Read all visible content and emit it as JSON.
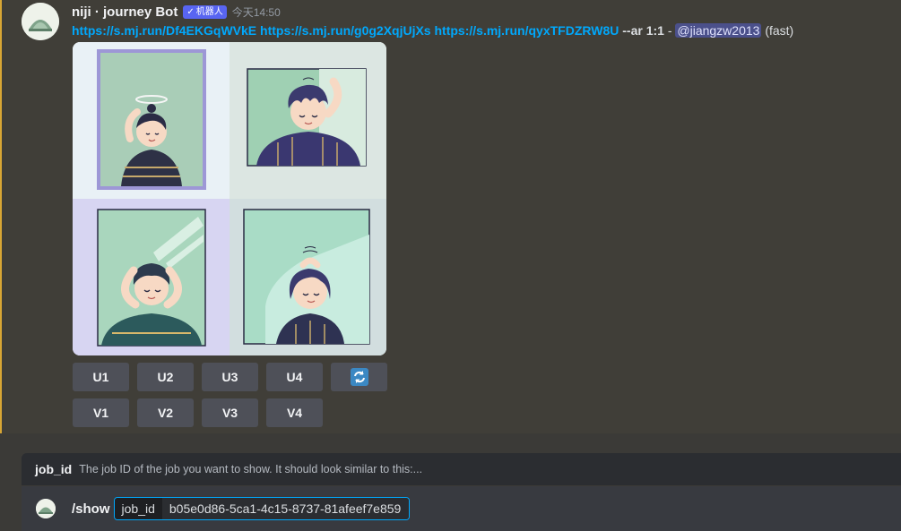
{
  "message": {
    "author": "niji · journey Bot",
    "bot_tag": "机器人",
    "timestamp": "今天14:50",
    "links": [
      "https://s.mj.run/Df4EKGqWVkE",
      "https://s.mj.run/g0g2XqjUjXs",
      "https://s.mj.run/qyxTFDZRW8U"
    ],
    "params": "--ar 1:1",
    "dash": "-",
    "mention": "@jiangzw2013",
    "speed": "(fast)"
  },
  "upscale_buttons": [
    "U1",
    "U2",
    "U3",
    "U4"
  ],
  "variation_buttons": [
    "V1",
    "V2",
    "V3",
    "V4"
  ],
  "reroll_icon": "refresh-icon",
  "command_hint": {
    "option": "job_id",
    "description": "The job ID of the job you want to show. It should look similar to this:..."
  },
  "input": {
    "command": "/show",
    "option_name": "job_id",
    "option_value": "b05e0d86-5ca1-4c15-8737-81afeef7e859"
  },
  "colors": {
    "accent_link": "#00a8fc",
    "bot_tag": "#5865f2",
    "highlight_bar": "#d8a634",
    "button": "#4e5058"
  }
}
